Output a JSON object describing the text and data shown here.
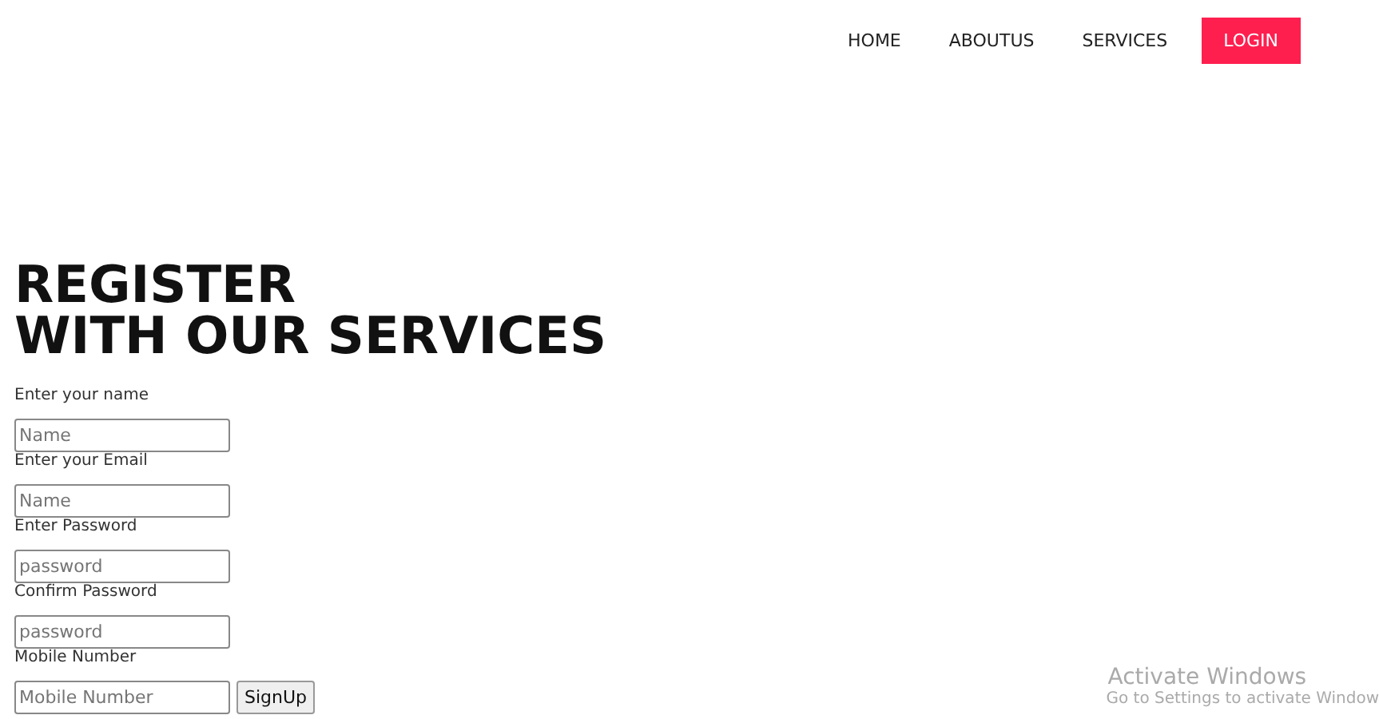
{
  "nav": {
    "items": [
      {
        "label": "HOME",
        "kind": "link"
      },
      {
        "label": "ABOUTUS",
        "kind": "link"
      },
      {
        "label": "SERVICES",
        "kind": "link"
      },
      {
        "label": "LOGIN",
        "kind": "button"
      }
    ]
  },
  "heading": {
    "lines": [
      "REGISTER",
      "WITH OUR SERVICES"
    ]
  },
  "form": {
    "fields": [
      {
        "label": "Enter your name",
        "placeholder": "Name"
      },
      {
        "label": "Enter your Email",
        "placeholder": "Name"
      },
      {
        "label": "Enter Password",
        "placeholder": "password"
      },
      {
        "label": "Confirm Password",
        "placeholder": "password"
      },
      {
        "label": "Mobile Number",
        "placeholder": "Mobile Number"
      }
    ],
    "submit": "SignUp"
  },
  "os_overlay": {
    "title": "Activate Windows",
    "subtitle": "Go to Settings to activate Window"
  }
}
